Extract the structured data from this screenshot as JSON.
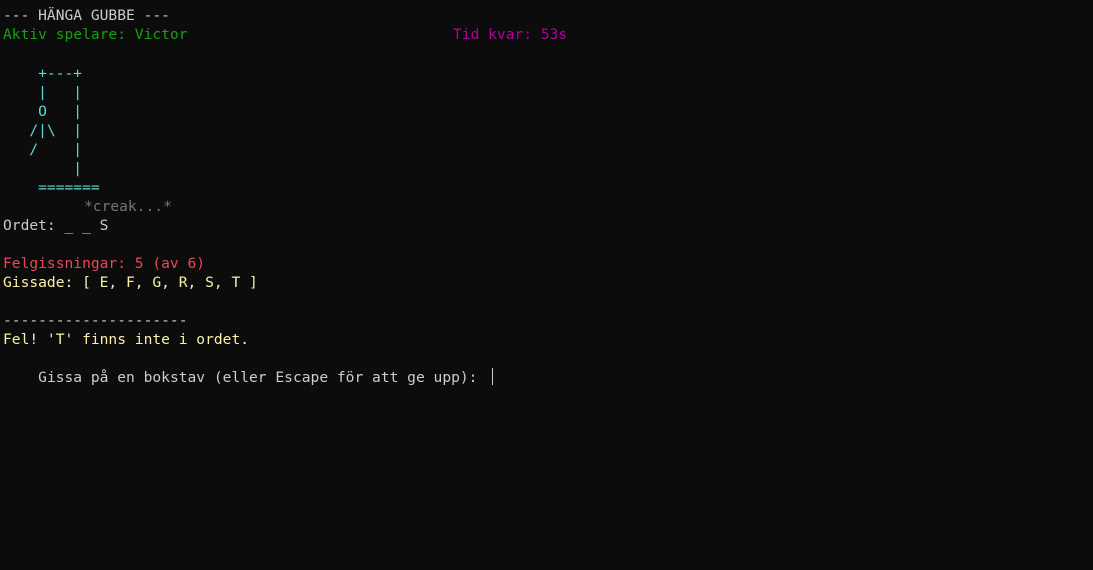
{
  "colors": {
    "background": "#0c0c0c",
    "default_text": "#cccccc",
    "green": "#13a10e",
    "magenta": "#b4009e",
    "cyan": "#61d6d6",
    "gray": "#767676",
    "red": "#e74856",
    "yellow": "#f9f1a5",
    "cursor": "#cccccc"
  },
  "header": {
    "title": "--- HÄNGA GUBBE ---",
    "active_player": "Aktiv spelare: Victor",
    "time_left": "Tid kvar: 53s"
  },
  "gallows": {
    "art": "    +---+\n    |   |\n    O   |\n   /|\\  |\n   /    |\n        |\n    =======",
    "sound": "*creak...*"
  },
  "word": {
    "display": "Ordet: _ _ S"
  },
  "status": {
    "wrong_guesses": "Felgissningar: 5 (av 6)",
    "guessed": "Gissade: [ E, F, G, R, S, T ]",
    "separator": "---------------------",
    "message": "Fel! 'T' finns inte i ordet."
  },
  "prompt": {
    "text": "Gissa på en bokstav (eller Escape för att ge upp): ",
    "input_value": ""
  }
}
